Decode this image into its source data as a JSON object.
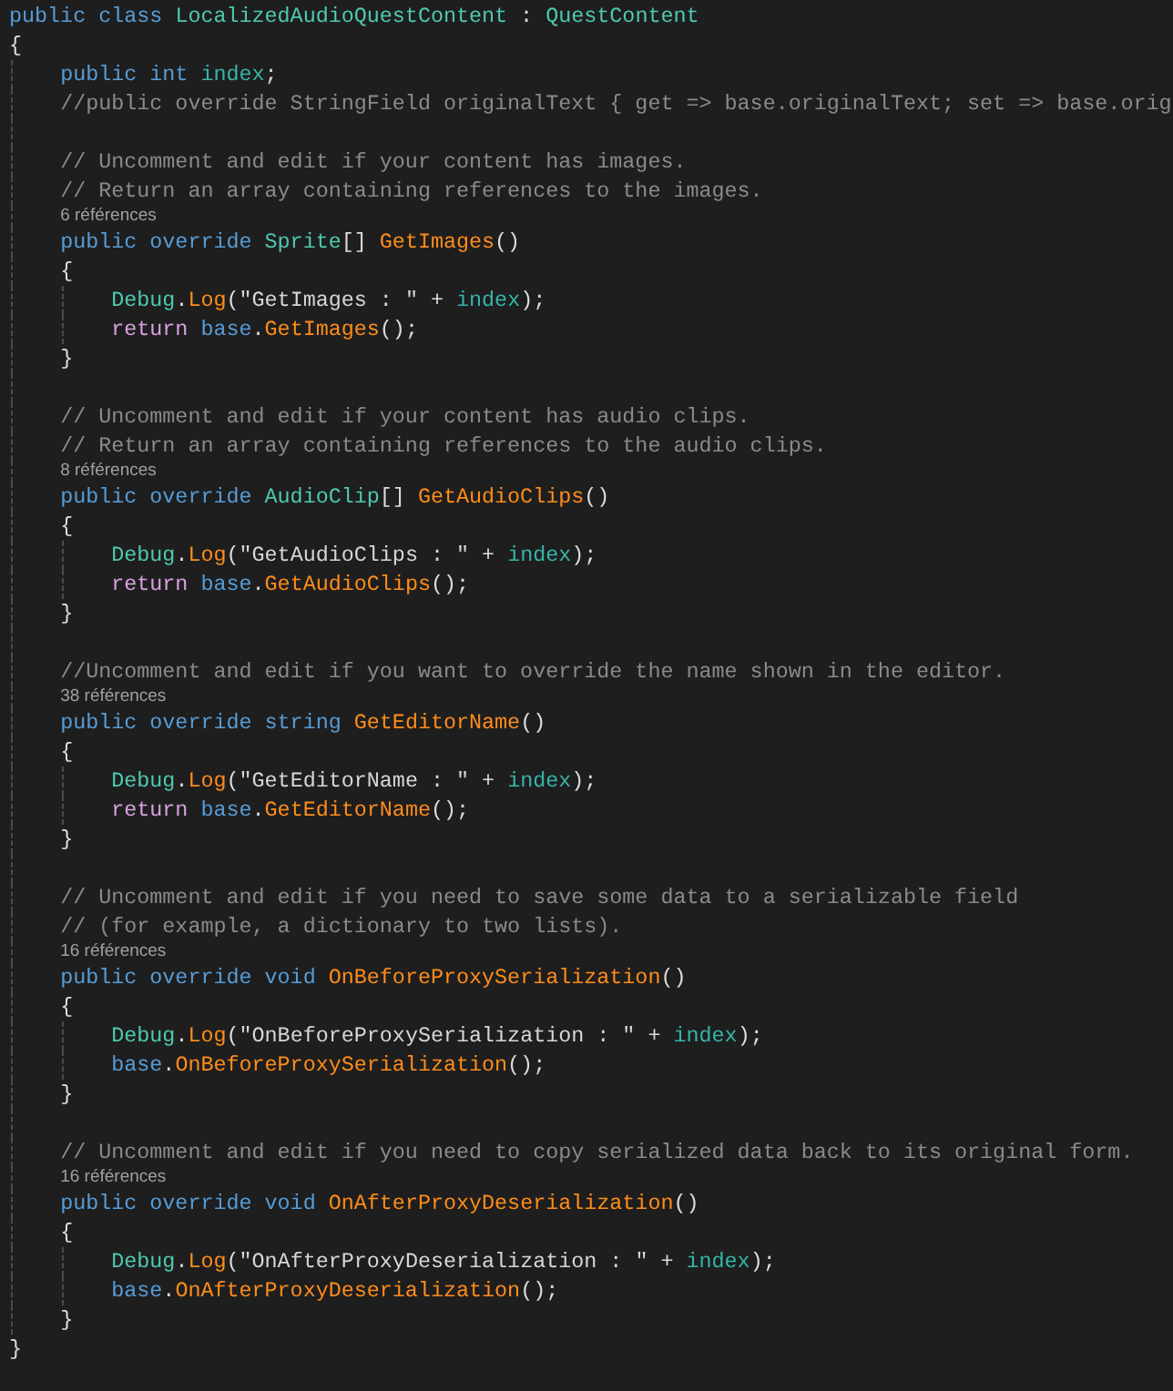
{
  "editor": {
    "lines": [
      {
        "kind": "code",
        "tokens": [
          {
            "kind": "keyword",
            "text": "public class "
          },
          {
            "kind": "type",
            "text": "LocalizedAudioQuestContent"
          },
          {
            "kind": "plain",
            "text": " : "
          },
          {
            "kind": "type",
            "text": "QuestContent"
          }
        ]
      },
      {
        "kind": "code",
        "tokens": [
          {
            "kind": "plain",
            "text": "{"
          }
        ]
      },
      {
        "kind": "code",
        "tokens": [
          {
            "kind": "keyword",
            "text": "    public int "
          },
          {
            "kind": "field",
            "text": "index"
          },
          {
            "kind": "plain",
            "text": ";"
          }
        ]
      },
      {
        "kind": "code",
        "tokens": [
          {
            "kind": "comment",
            "text": "    //public override StringField originalText { get => base.originalText; set => base.orig"
          }
        ]
      },
      {
        "kind": "blank"
      },
      {
        "kind": "code",
        "tokens": [
          {
            "kind": "comment",
            "text": "    // Uncomment and edit if your content has images."
          }
        ]
      },
      {
        "kind": "code",
        "tokens": [
          {
            "kind": "comment",
            "text": "    // Return an array containing references to the images."
          }
        ]
      },
      {
        "kind": "lens",
        "text": "6 références"
      },
      {
        "kind": "code",
        "tokens": [
          {
            "kind": "keyword",
            "text": "    public override "
          },
          {
            "kind": "type",
            "text": "Sprite"
          },
          {
            "kind": "plain",
            "text": "[] "
          },
          {
            "kind": "method",
            "text": "GetImages"
          },
          {
            "kind": "plain",
            "text": "()"
          }
        ]
      },
      {
        "kind": "code",
        "tokens": [
          {
            "kind": "plain",
            "text": "    {"
          }
        ]
      },
      {
        "kind": "code",
        "tokens": [
          {
            "kind": "type",
            "text": "        Debug"
          },
          {
            "kind": "plain",
            "text": "."
          },
          {
            "kind": "method",
            "text": "Log"
          },
          {
            "kind": "plain",
            "text": "("
          },
          {
            "kind": "string",
            "text": "\"GetImages : \""
          },
          {
            "kind": "plain",
            "text": " + "
          },
          {
            "kind": "field",
            "text": "index"
          },
          {
            "kind": "plain",
            "text": ");"
          }
        ]
      },
      {
        "kind": "code",
        "tokens": [
          {
            "kind": "control",
            "text": "        return "
          },
          {
            "kind": "keyword",
            "text": "base"
          },
          {
            "kind": "plain",
            "text": "."
          },
          {
            "kind": "method",
            "text": "GetImages"
          },
          {
            "kind": "plain",
            "text": "();"
          }
        ]
      },
      {
        "kind": "code",
        "tokens": [
          {
            "kind": "plain",
            "text": "    }"
          }
        ]
      },
      {
        "kind": "blank"
      },
      {
        "kind": "code",
        "tokens": [
          {
            "kind": "comment",
            "text": "    // Uncomment and edit if your content has audio clips."
          }
        ]
      },
      {
        "kind": "code",
        "tokens": [
          {
            "kind": "comment",
            "text": "    // Return an array containing references to the audio clips."
          }
        ]
      },
      {
        "kind": "lens",
        "text": "8 références"
      },
      {
        "kind": "code",
        "tokens": [
          {
            "kind": "keyword",
            "text": "    public override "
          },
          {
            "kind": "type",
            "text": "AudioClip"
          },
          {
            "kind": "plain",
            "text": "[] "
          },
          {
            "kind": "method",
            "text": "GetAudioClips"
          },
          {
            "kind": "plain",
            "text": "()"
          }
        ]
      },
      {
        "kind": "code",
        "tokens": [
          {
            "kind": "plain",
            "text": "    {"
          }
        ]
      },
      {
        "kind": "code",
        "tokens": [
          {
            "kind": "type",
            "text": "        Debug"
          },
          {
            "kind": "plain",
            "text": "."
          },
          {
            "kind": "method",
            "text": "Log"
          },
          {
            "kind": "plain",
            "text": "("
          },
          {
            "kind": "string",
            "text": "\"GetAudioClips : \""
          },
          {
            "kind": "plain",
            "text": " + "
          },
          {
            "kind": "field",
            "text": "index"
          },
          {
            "kind": "plain",
            "text": ");"
          }
        ]
      },
      {
        "kind": "code",
        "tokens": [
          {
            "kind": "control",
            "text": "        return "
          },
          {
            "kind": "keyword",
            "text": "base"
          },
          {
            "kind": "plain",
            "text": "."
          },
          {
            "kind": "method",
            "text": "GetAudioClips"
          },
          {
            "kind": "plain",
            "text": "();"
          }
        ]
      },
      {
        "kind": "code",
        "tokens": [
          {
            "kind": "plain",
            "text": "    }"
          }
        ]
      },
      {
        "kind": "blank"
      },
      {
        "kind": "code",
        "tokens": [
          {
            "kind": "comment",
            "text": "    //Uncomment and edit if you want to override the name shown in the editor."
          }
        ]
      },
      {
        "kind": "lens",
        "text": "38 références"
      },
      {
        "kind": "code",
        "tokens": [
          {
            "kind": "keyword",
            "text": "    public override string "
          },
          {
            "kind": "method",
            "text": "GetEditorName"
          },
          {
            "kind": "plain",
            "text": "()"
          }
        ]
      },
      {
        "kind": "code",
        "tokens": [
          {
            "kind": "plain",
            "text": "    {"
          }
        ]
      },
      {
        "kind": "code",
        "tokens": [
          {
            "kind": "type",
            "text": "        Debug"
          },
          {
            "kind": "plain",
            "text": "."
          },
          {
            "kind": "method",
            "text": "Log"
          },
          {
            "kind": "plain",
            "text": "("
          },
          {
            "kind": "string",
            "text": "\"GetEditorName : \""
          },
          {
            "kind": "plain",
            "text": " + "
          },
          {
            "kind": "field",
            "text": "index"
          },
          {
            "kind": "plain",
            "text": ");"
          }
        ]
      },
      {
        "kind": "code",
        "tokens": [
          {
            "kind": "control",
            "text": "        return "
          },
          {
            "kind": "keyword",
            "text": "base"
          },
          {
            "kind": "plain",
            "text": "."
          },
          {
            "kind": "method",
            "text": "GetEditorName"
          },
          {
            "kind": "plain",
            "text": "();"
          }
        ]
      },
      {
        "kind": "code",
        "tokens": [
          {
            "kind": "plain",
            "text": "    }"
          }
        ]
      },
      {
        "kind": "blank"
      },
      {
        "kind": "code",
        "tokens": [
          {
            "kind": "comment",
            "text": "    // Uncomment and edit if you need to save some data to a serializable field"
          }
        ]
      },
      {
        "kind": "code",
        "tokens": [
          {
            "kind": "comment",
            "text": "    // (for example, a dictionary to two lists)."
          }
        ]
      },
      {
        "kind": "lens",
        "text": "16 références"
      },
      {
        "kind": "code",
        "tokens": [
          {
            "kind": "keyword",
            "text": "    public override void "
          },
          {
            "kind": "method",
            "text": "OnBeforeProxySerialization"
          },
          {
            "kind": "plain",
            "text": "()"
          }
        ]
      },
      {
        "kind": "code",
        "tokens": [
          {
            "kind": "plain",
            "text": "    {"
          }
        ]
      },
      {
        "kind": "code",
        "tokens": [
          {
            "kind": "type",
            "text": "        Debug"
          },
          {
            "kind": "plain",
            "text": "."
          },
          {
            "kind": "method",
            "text": "Log"
          },
          {
            "kind": "plain",
            "text": "("
          },
          {
            "kind": "string",
            "text": "\"OnBeforeProxySerialization : \""
          },
          {
            "kind": "plain",
            "text": " + "
          },
          {
            "kind": "field",
            "text": "index"
          },
          {
            "kind": "plain",
            "text": ");"
          }
        ]
      },
      {
        "kind": "code",
        "tokens": [
          {
            "kind": "keyword",
            "text": "        base"
          },
          {
            "kind": "plain",
            "text": "."
          },
          {
            "kind": "method",
            "text": "OnBeforeProxySerialization"
          },
          {
            "kind": "plain",
            "text": "();"
          }
        ]
      },
      {
        "kind": "code",
        "tokens": [
          {
            "kind": "plain",
            "text": "    }"
          }
        ]
      },
      {
        "kind": "blank"
      },
      {
        "kind": "code",
        "tokens": [
          {
            "kind": "comment",
            "text": "    // Uncomment and edit if you need to copy serialized data back to its original form."
          }
        ]
      },
      {
        "kind": "lens",
        "text": "16 références"
      },
      {
        "kind": "code",
        "tokens": [
          {
            "kind": "keyword",
            "text": "    public override void "
          },
          {
            "kind": "method",
            "text": "OnAfterProxyDeserialization"
          },
          {
            "kind": "plain",
            "text": "()"
          }
        ]
      },
      {
        "kind": "code",
        "tokens": [
          {
            "kind": "plain",
            "text": "    {"
          }
        ]
      },
      {
        "kind": "code",
        "tokens": [
          {
            "kind": "type",
            "text": "        Debug"
          },
          {
            "kind": "plain",
            "text": "."
          },
          {
            "kind": "method",
            "text": "Log"
          },
          {
            "kind": "plain",
            "text": "("
          },
          {
            "kind": "string",
            "text": "\"OnAfterProxyDeserialization : \""
          },
          {
            "kind": "plain",
            "text": " + "
          },
          {
            "kind": "field",
            "text": "index"
          },
          {
            "kind": "plain",
            "text": ");"
          }
        ]
      },
      {
        "kind": "code",
        "tokens": [
          {
            "kind": "keyword",
            "text": "        base"
          },
          {
            "kind": "plain",
            "text": "."
          },
          {
            "kind": "method",
            "text": "OnAfterProxyDeserialization"
          },
          {
            "kind": "plain",
            "text": "();"
          }
        ]
      },
      {
        "kind": "code",
        "tokens": [
          {
            "kind": "plain",
            "text": "    }"
          }
        ]
      },
      {
        "kind": "code",
        "tokens": [
          {
            "kind": "plain",
            "text": "}"
          }
        ]
      }
    ]
  }
}
